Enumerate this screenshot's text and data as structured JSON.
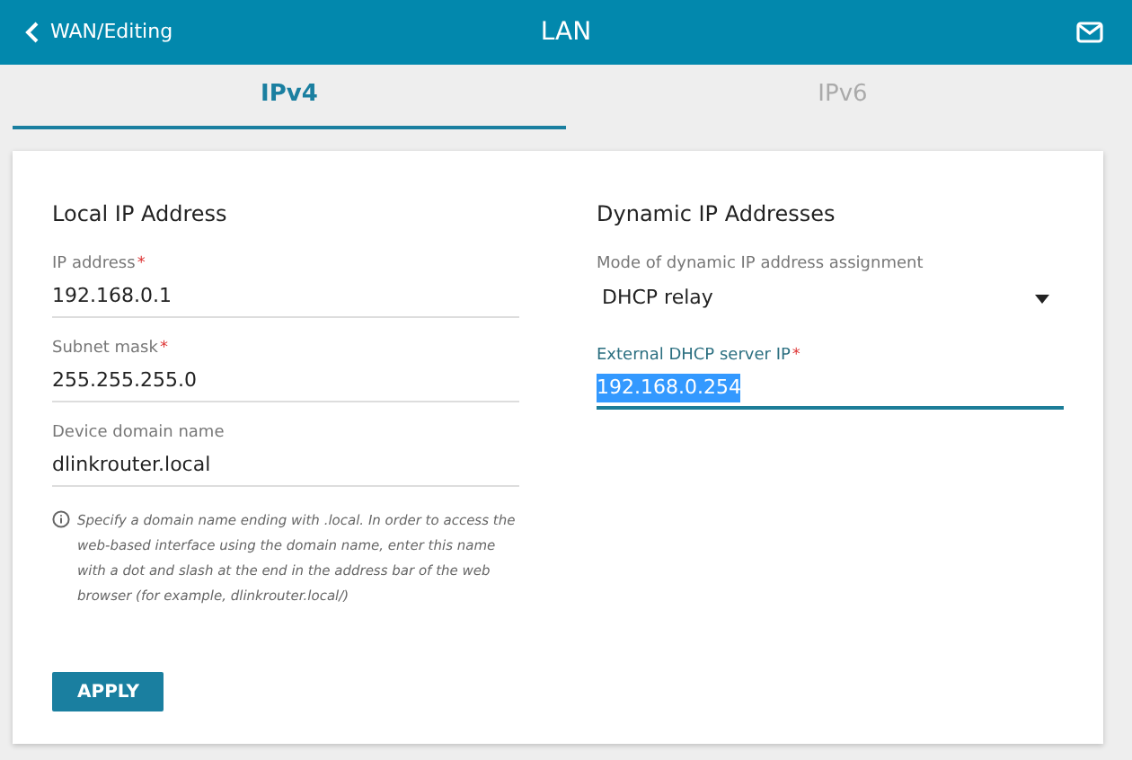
{
  "header": {
    "back_label": "WAN/Editing",
    "title": "LAN"
  },
  "tabs": [
    {
      "label": "IPv4",
      "selected": true
    },
    {
      "label": "IPv6",
      "selected": false
    }
  ],
  "sections": [
    {
      "title": "Local IP Address",
      "fields": [
        {
          "kind": "text",
          "label": "IP address",
          "required_mark": "*",
          "value": "192.168.0.1",
          "focused": false
        },
        {
          "kind": "text",
          "label": "Subnet mask",
          "required_mark": "*",
          "value": "255.255.255.0",
          "focused": false
        },
        {
          "kind": "text",
          "label": "Device domain name",
          "value": "dlinkrouter.local",
          "focused": false
        }
      ],
      "hint": "Specify a domain name ending with .local. In order to access the web-based interface using the domain name, enter this name with a dot and slash at the end in the address bar of the web browser (for example, dlinkrouter.local/)"
    },
    {
      "title": "Dynamic IP Addresses",
      "fields": [
        {
          "kind": "select",
          "label": "Mode of dynamic IP address assignment",
          "value": "DHCP relay"
        },
        {
          "kind": "text",
          "label": "External DHCP server IP",
          "required_mark": "*",
          "value": "192.168.0.254",
          "focused": true
        }
      ]
    }
  ],
  "apply_button": "APPLY"
}
